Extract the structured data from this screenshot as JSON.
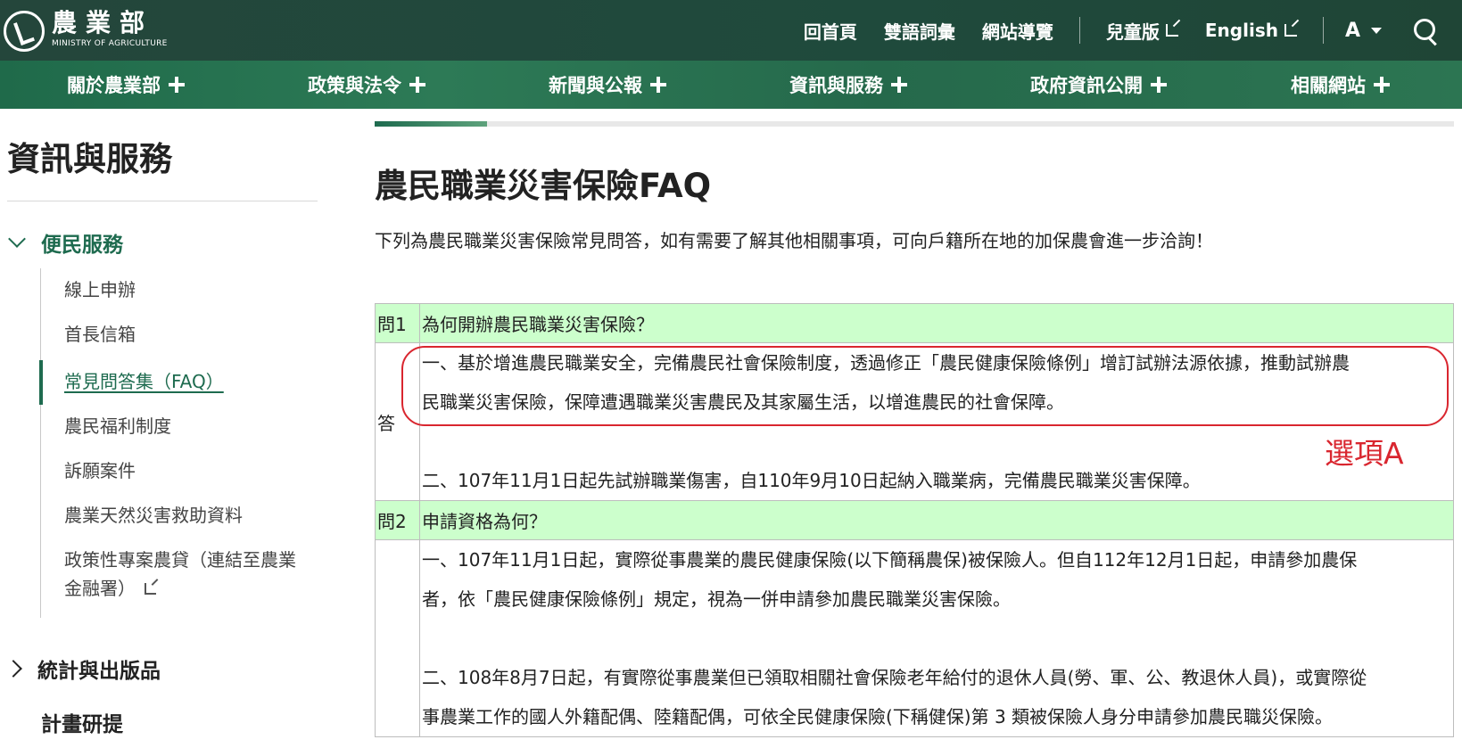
{
  "header": {
    "logo_cn": "農業部",
    "logo_en": "MINISTRY OF AGRICULTURE",
    "links": [
      {
        "label": "回首頁"
      },
      {
        "label": "雙語詞彙"
      },
      {
        "label": "網站導覽"
      },
      {
        "label": "兒童版"
      },
      {
        "label": "English"
      }
    ],
    "font_size_label": "A"
  },
  "mainnav": {
    "items": [
      "關於農業部",
      "政策與法令",
      "新聞與公報",
      "資訊與服務",
      "政府資訊公開",
      "相關網站"
    ]
  },
  "sidebar": {
    "title": "資訊與服務",
    "open_category": "便民服務",
    "sub_items": [
      "線上申辦",
      "首長信箱",
      "常見問答集（FAQ）",
      "農民福利制度",
      "訴願案件",
      "農業天然災害救助資料",
      "政策性專案農貸（連結至農業",
      "金融署）"
    ],
    "closed_category": "統計與出版品",
    "plain_category": "計畫研提"
  },
  "content": {
    "title": "農民職業災害保險FAQ",
    "intro": "下列為農民職業災害保險常見問答，如有需要了解其他相關事項，可向戶籍所在地的加保農會進一步洽詢！",
    "faq": [
      {
        "q_no": "問1",
        "question": "為何開辦農民職業災害保險？",
        "a_label": "答",
        "answer_lines": [
          "一、基於增進農民職業安全，完備農民社會保險制度，透過修正「農民健康保險條例」增訂試辦法源依據，推動試辦農",
          "民職業災害保險，保障遭遇職業災害農民及其家屬生活，以增進農民的社會保障。",
          "二、107年11月1日起先試辦職業傷害，自110年9月10日起納入職業病，完備農民職業災害保障。"
        ]
      },
      {
        "q_no": "問2",
        "question": "申請資格為何？",
        "answer_lines": [
          "一、107年11月1日起，實際從事農業的農民健康保險(以下簡稱農保)被保險人。但自112年12月1日起，申請參加農保",
          "者，依「農民健康保險條例」規定，視為一併申請參加農民職業災害保險。",
          "二、108年8月7日起，有實際從事農業但已領取相關社會保險老年給付的退休人員(勞、軍、公、教退休人員)，或實際從",
          "事農業工作的國人外籍配偶、陸籍配偶，可依全民健康保險(下稱健保)第 3 類被保險人身分申請參加農民職災保險。"
        ]
      }
    ]
  },
  "annotation": {
    "label": "選項A",
    "color": "#d9262f"
  }
}
